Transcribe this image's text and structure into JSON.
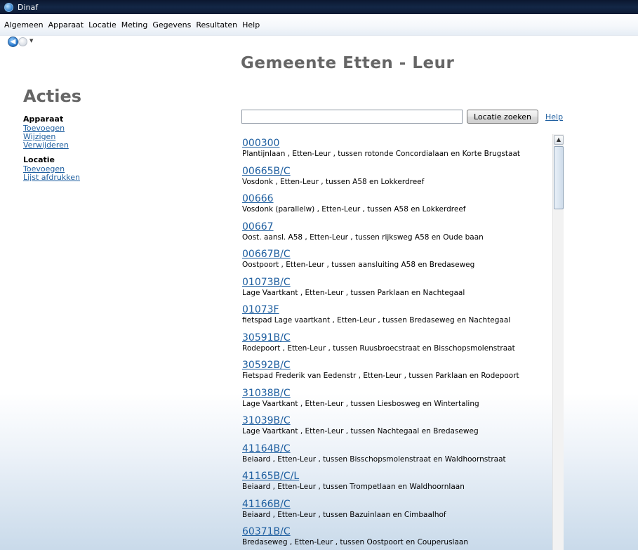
{
  "window": {
    "title": "Dinaf"
  },
  "menu": [
    "Algemeen",
    "Apparaat",
    "Locatie",
    "Meting",
    "Gegevens",
    "Resultaten",
    "Help"
  ],
  "page": {
    "title": "Gemeente Etten - Leur"
  },
  "sidebar": {
    "heading": "Acties",
    "groups": [
      {
        "title": "Apparaat",
        "links": [
          "Toevoegen",
          "Wijzigen",
          "Verwijderen"
        ]
      },
      {
        "title": "Locatie",
        "links": [
          "Toevoegen",
          "Lijst afdrukken"
        ]
      }
    ]
  },
  "search": {
    "value": "",
    "button_label": "Locatie zoeken",
    "help_label": "Help"
  },
  "results": [
    {
      "code": "000300",
      "desc": "Plantijnlaan ,  Etten-Leur ,  tussen rotonde Concordialaan en Korte Brugstaat"
    },
    {
      "code": "00665B/C",
      "desc": "Vosdonk ,  Etten-Leur ,  tussen A58 en Lokkerdreef"
    },
    {
      "code": "00666",
      "desc": "Vosdonk (parallelw) ,  Etten-Leur ,  tussen A58 en Lokkerdreef"
    },
    {
      "code": "00667",
      "desc": "Oost. aansl. A58 ,  Etten-Leur ,  tussen rijksweg A58 en Oude baan"
    },
    {
      "code": "00667B/C",
      "desc": "Oostpoort ,  Etten-Leur ,  tussen aansluiting A58 en Bredaseweg"
    },
    {
      "code": "01073B/C",
      "desc": "Lage Vaartkant ,  Etten-Leur ,  tussen Parklaan en Nachtegaal"
    },
    {
      "code": "01073F",
      "desc": "fietspad Lage vaartkant ,  Etten-Leur ,  tussen Bredaseweg en Nachtegaal"
    },
    {
      "code": "30591B/C",
      "desc": "Rodepoort ,  Etten-Leur ,  tussen Ruusbroecstraat en Bisschopsmolenstraat"
    },
    {
      "code": "30592B/C",
      "desc": "Fietspad Frederik van Eedenstr ,  Etten-Leur ,  tussen Parklaan en Rodepoort"
    },
    {
      "code": "31038B/C",
      "desc": "Lage Vaartkant ,  Etten-Leur ,  tussen Liesbosweg en Wintertaling"
    },
    {
      "code": "31039B/C",
      "desc": "Lage Vaartkant ,  Etten-Leur ,  tussen Nachtegaal en Bredaseweg"
    },
    {
      "code": "41164B/C",
      "desc": "Beiaard ,  Etten-Leur ,  tussen Bisschopsmolenstraat en Waldhoornstraat"
    },
    {
      "code": "41165B/C/L",
      "desc": "Beiaard ,  Etten-Leur ,  tussen Trompetlaan en Waldhoornlaan"
    },
    {
      "code": "41166B/C",
      "desc": "Beiaard ,  Etten-Leur ,  tussen Bazuinlaan en Cimbaalhof"
    },
    {
      "code": "60371B/C",
      "desc": "Bredaseweg ,  Etten-Leur ,  tussen Oostpoort en Couperuslaan"
    }
  ]
}
